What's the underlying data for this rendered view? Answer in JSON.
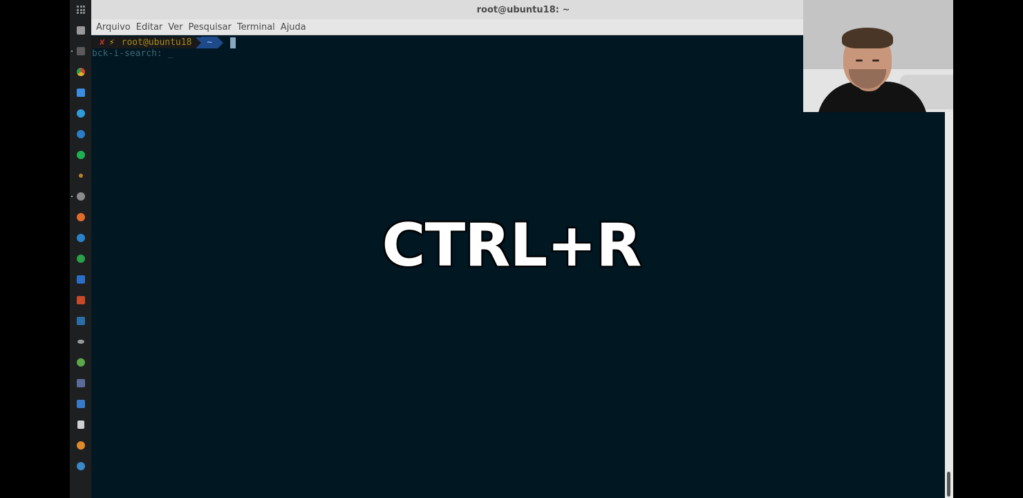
{
  "window": {
    "title": "root@ubuntu18: ~"
  },
  "menubar": {
    "items": [
      "Arquivo",
      "Editar",
      "Ver",
      "Pesquisar",
      "Terminal",
      "Ajuda"
    ]
  },
  "terminal": {
    "prompt": {
      "status_icon": "✘",
      "bolt_icon": "⚡",
      "user_host": "root@ubuntu18",
      "dir": "~"
    },
    "search_line": "bck-i-search: _"
  },
  "overlay": {
    "shortcut_text": "CTRL+R"
  },
  "dock": {
    "icons": [
      {
        "name": "show-apps-icon"
      },
      {
        "name": "files-icon",
        "color": "#9a9a9a"
      },
      {
        "name": "terminal-icon",
        "color": "#5a5a5a",
        "running": true
      },
      {
        "name": "chrome-icon",
        "color": "#e0b12a"
      },
      {
        "name": "google-drive-icon",
        "color": "#3a8de0"
      },
      {
        "name": "telegram-icon",
        "color": "#2f9bd8"
      },
      {
        "name": "skype-icon",
        "color": "#2a7ec8"
      },
      {
        "name": "spotify-icon",
        "color": "#1fb14f"
      },
      {
        "name": "app-dot-icon",
        "color": "#b8822a"
      },
      {
        "name": "settings-icon",
        "color": "#8a8a8a",
        "running": true
      },
      {
        "name": "postman-icon",
        "color": "#e06b2a"
      },
      {
        "name": "sublime-icon",
        "color": "#2a82c8"
      },
      {
        "name": "gitkraken-icon",
        "color": "#2aa04a"
      },
      {
        "name": "vscode-icon",
        "color": "#2a6ec8"
      },
      {
        "name": "filezilla-icon",
        "color": "#c84a2a"
      },
      {
        "name": "vm-icon",
        "color": "#2a6ea8"
      },
      {
        "name": "app-face-icon",
        "color": "#9a9a9a"
      },
      {
        "name": "leaf-app-icon",
        "color": "#5aa84a"
      },
      {
        "name": "app-grid-icon",
        "color": "#5a6a9a"
      },
      {
        "name": "app-window-icon",
        "color": "#3a78c8"
      },
      {
        "name": "document-icon",
        "color": "#cfcfcf"
      },
      {
        "name": "firefox-icon",
        "color": "#e08a2a"
      },
      {
        "name": "headphones-icon",
        "color": "#3a88c8"
      }
    ]
  }
}
